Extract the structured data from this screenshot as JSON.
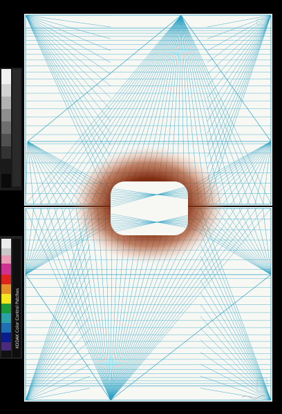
{
  "artwork": {
    "background_color": "#000000",
    "paper_color": "#f7f7f3",
    "grid_color": "#2aa2c4",
    "glow_color": "#8a2a08",
    "void_color": "#f7f7f3"
  },
  "calibration_strip": {
    "label": "KODAK Color Control Patches",
    "patches": [
      "#0b1d8c",
      "#1f6fb5",
      "#1d9a3a",
      "#f2e81d",
      "#e0221c",
      "#d0308f",
      "#2a1a12",
      "#f4f4f0"
    ]
  }
}
